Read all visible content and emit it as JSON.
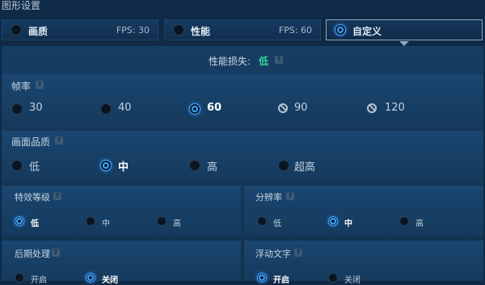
{
  "header": {
    "title": "图形设置"
  },
  "presets": [
    {
      "label": "画质",
      "fps": "FPS: 30",
      "selected": false
    },
    {
      "label": "性能",
      "fps": "FPS: 60",
      "selected": false
    },
    {
      "label": "自定义",
      "fps": "",
      "selected": true
    }
  ],
  "performance": {
    "label": "性能损失:",
    "value": "低",
    "help": "?"
  },
  "frame_rate": {
    "title": "帧率",
    "options": [
      {
        "label": "30",
        "state": "off"
      },
      {
        "label": "40",
        "state": "off"
      },
      {
        "label": "60",
        "state": "on"
      },
      {
        "label": "90",
        "state": "disabled"
      },
      {
        "label": "120",
        "state": "disabled"
      }
    ]
  },
  "picture_quality": {
    "title": "画面品质",
    "options": [
      {
        "label": "低",
        "state": "off"
      },
      {
        "label": "中",
        "state": "on"
      },
      {
        "label": "高",
        "state": "off"
      },
      {
        "label": "超高",
        "state": "off"
      }
    ]
  },
  "effects_level": {
    "title": "特效等级",
    "options": [
      {
        "label": "低",
        "state": "on"
      },
      {
        "label": "中",
        "state": "off"
      },
      {
        "label": "高",
        "state": "off"
      }
    ]
  },
  "resolution": {
    "title": "分辨率",
    "options": [
      {
        "label": "低",
        "state": "off"
      },
      {
        "label": "中",
        "state": "on"
      },
      {
        "label": "高",
        "state": "off"
      }
    ]
  },
  "post_processing": {
    "title": "后期处理",
    "options": [
      {
        "label": "开启",
        "state": "off"
      },
      {
        "label": "关闭",
        "state": "on"
      }
    ]
  },
  "floating_text": {
    "title": "浮动文字",
    "options": [
      {
        "label": "开启",
        "state": "on"
      },
      {
        "label": "关闭",
        "state": "off"
      }
    ]
  },
  "colors": {
    "accent": "#3fa7ff",
    "perf_good": "#34d6a0",
    "panel": "#163d63"
  }
}
